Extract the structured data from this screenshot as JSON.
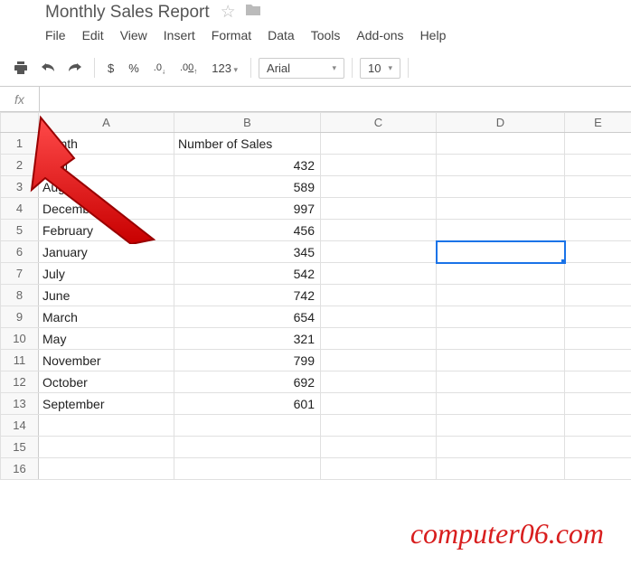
{
  "doc": {
    "title": "Monthly Sales Report"
  },
  "menu": {
    "file": "File",
    "edit": "Edit",
    "view": "View",
    "insert": "Insert",
    "format": "Format",
    "data": "Data",
    "tools": "Tools",
    "addons": "Add-ons",
    "help": "Help"
  },
  "toolbar": {
    "currency": "$",
    "percent": "%",
    "dec_dec": ".0",
    "inc_dec": ".00",
    "more_formats": "123",
    "font": "Arial",
    "fontsize": "10"
  },
  "fx": {
    "label": "fx",
    "value": ""
  },
  "columns": {
    "a": "A",
    "b": "B",
    "c": "C",
    "d": "D",
    "e": "E"
  },
  "headers": {
    "a": "Month",
    "b": "Number of Sales"
  },
  "rows": [
    {
      "n": "1"
    },
    {
      "n": "2",
      "a": "April",
      "b": "432"
    },
    {
      "n": "3",
      "a": "August",
      "b": "589"
    },
    {
      "n": "4",
      "a": "December",
      "b": "997"
    },
    {
      "n": "5",
      "a": "February",
      "b": "456"
    },
    {
      "n": "6",
      "a": "January",
      "b": "345"
    },
    {
      "n": "7",
      "a": "July",
      "b": "542"
    },
    {
      "n": "8",
      "a": "June",
      "b": "742"
    },
    {
      "n": "9",
      "a": "March",
      "b": "654"
    },
    {
      "n": "10",
      "a": "May",
      "b": "321"
    },
    {
      "n": "11",
      "a": "November",
      "b": "799"
    },
    {
      "n": "12",
      "a": "October",
      "b": "692"
    },
    {
      "n": "13",
      "a": "September",
      "b": "601"
    },
    {
      "n": "14"
    },
    {
      "n": "15"
    },
    {
      "n": "16"
    }
  ],
  "chart_data": {
    "type": "table",
    "title": "Monthly Sales Report",
    "columns": [
      "Month",
      "Number of Sales"
    ],
    "data": [
      [
        "April",
        432
      ],
      [
        "August",
        589
      ],
      [
        "December",
        997
      ],
      [
        "February",
        456
      ],
      [
        "January",
        345
      ],
      [
        "July",
        542
      ],
      [
        "June",
        742
      ],
      [
        "March",
        654
      ],
      [
        "May",
        321
      ],
      [
        "November",
        799
      ],
      [
        "October",
        692
      ],
      [
        "September",
        601
      ]
    ]
  },
  "watermark": "computer06.com"
}
